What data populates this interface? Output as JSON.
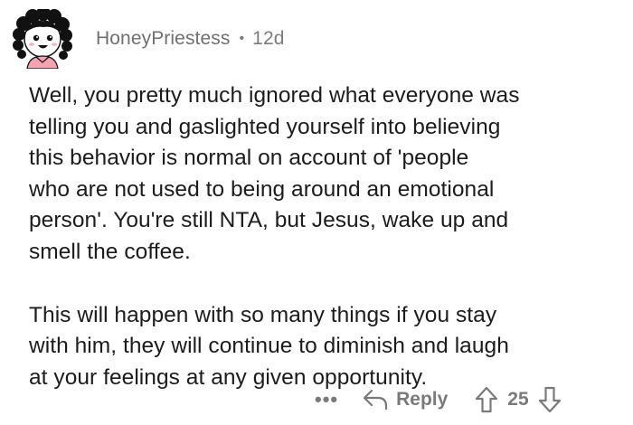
{
  "comment": {
    "username": "HoneyPriestess",
    "separator": "•",
    "age": "12d",
    "paragraphs": [
      "Well, you pretty much ignored what everyone was\ntelling you and gaslighted yourself into believing\nthis  behavior is normal on account of 'people\nwho are not used to being around an emotional\nperson'. You're still NTA, but Jesus, wake up and\nsmell the coffee.",
      "This will happen with so many things if you stay\nwith him, they will continue to diminish and laugh\nat your feelings at any given opportunity."
    ],
    "actions": {
      "more_label": "•••",
      "reply_label": "Reply",
      "score": "25"
    }
  },
  "icons": {
    "avatar": "cartoon-avatar-icon",
    "reply": "reply-arrow-icon",
    "upvote": "upvote-arrow-icon",
    "downvote": "downvote-arrow-icon"
  },
  "colors": {
    "meta_text": "#7c7c7c",
    "body_text": "#1c1c1c",
    "action_text": "#7a7a7a",
    "avatar_shirt": "#f5a3b0",
    "background": "#ffffff"
  }
}
